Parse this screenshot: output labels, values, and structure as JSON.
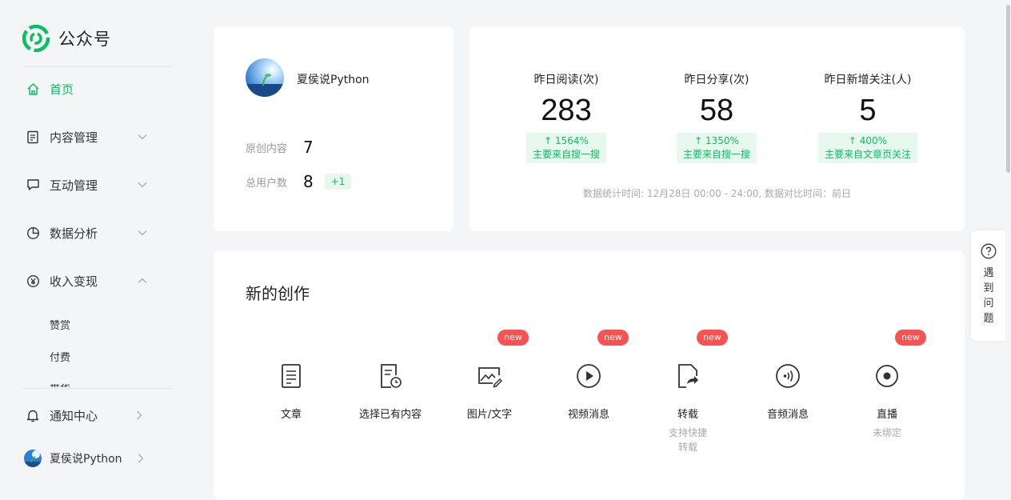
{
  "brand": {
    "name": "公众号"
  },
  "sidebar": {
    "items": [
      {
        "label": "首页",
        "icon": "home-icon"
      },
      {
        "label": "内容管理",
        "icon": "document-icon"
      },
      {
        "label": "互动管理",
        "icon": "chat-icon"
      },
      {
        "label": "数据分析",
        "icon": "pie-chart-icon"
      },
      {
        "label": "收入变现",
        "icon": "yen-icon"
      }
    ],
    "sub_items": [
      "赞赏",
      "付费",
      "带货"
    ],
    "bottom": [
      {
        "label": "通知中心",
        "icon": "bell-icon"
      },
      {
        "label": "夏侯说Python",
        "icon": "avatar"
      }
    ]
  },
  "account": {
    "name": "夏侯说Python",
    "original_label": "原创内容",
    "original_value": "7",
    "users_label": "总用户数",
    "users_value": "8",
    "users_delta": "+1"
  },
  "stats": {
    "items": [
      {
        "label": "昨日阅读(次)",
        "value": "283",
        "change": "↑ 1564%",
        "source": "主要来自搜一搜"
      },
      {
        "label": "昨日分享(次)",
        "value": "58",
        "change": "↑ 1350%",
        "source": "主要来自搜一搜"
      },
      {
        "label": "昨日新增关注(人)",
        "value": "5",
        "change": "↑ 400%",
        "source": "主要来自文章页关注"
      }
    ],
    "note": "数据统计时间: 12月28日 00:00 - 24:00, 数据对比时间：前日"
  },
  "create": {
    "title": "新的创作",
    "new_badge": "new",
    "items": [
      {
        "label": "文章",
        "sub1": "",
        "sub2": ""
      },
      {
        "label": "选择已有内容",
        "sub1": "",
        "sub2": ""
      },
      {
        "label": "图片/文字",
        "sub1": "",
        "sub2": ""
      },
      {
        "label": "视频消息",
        "sub1": "",
        "sub2": ""
      },
      {
        "label": "转载",
        "sub1": "支持快捷",
        "sub2": "转载"
      },
      {
        "label": "音频消息",
        "sub1": "",
        "sub2": ""
      },
      {
        "label": "直播",
        "sub1": "未绑定",
        "sub2": ""
      }
    ]
  },
  "help": {
    "text": "遇到问题"
  },
  "colors": {
    "accent": "#07c160",
    "badge_red": "#fa5151",
    "badge_bg": "#e7f8ee"
  }
}
